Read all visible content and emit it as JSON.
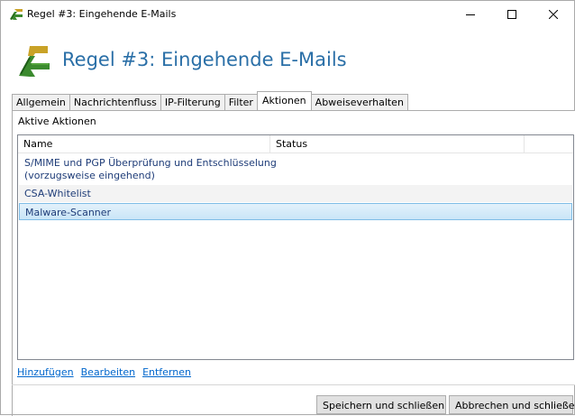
{
  "window": {
    "title": "Regel #3: Eingehende E-Mails",
    "controls": {
      "minimize": "minimize-icon",
      "maximize": "maximize-icon",
      "close": "close-icon"
    }
  },
  "header": {
    "title": "Regel #3: Eingehende E-Mails",
    "icon": "rule-arrows-icon"
  },
  "tabs": [
    {
      "label": "Allgemein",
      "active": false
    },
    {
      "label": "Nachrichtenfluss",
      "active": false
    },
    {
      "label": "IP-Filterung",
      "active": false
    },
    {
      "label": "Filter",
      "active": false
    },
    {
      "label": "Aktionen",
      "active": true
    },
    {
      "label": "Abweiseverhalten",
      "active": false
    }
  ],
  "actions": {
    "section_label": "Aktive Aktionen",
    "columns": {
      "name": "Name",
      "status": "Status"
    },
    "rows": [
      {
        "name_line1": "S/MIME und PGP Überprüfung und Entschlüsselung",
        "name_line2": "(vorzugsweise eingehend)",
        "status": ""
      },
      {
        "name": "CSA-Whitelist",
        "status": ""
      },
      {
        "name": "Malware-Scanner",
        "status": "",
        "selected": true
      }
    ]
  },
  "links": {
    "add": "Hinzufügen",
    "edit": "Bearbeiten",
    "remove": "Entfernen"
  },
  "buttons": {
    "save": "Speichern und schließen",
    "cancel": "Abbrechen und schließen"
  },
  "colors": {
    "header_title": "#2a6fa7",
    "link": "#0066cc",
    "row_text": "#1e3c78",
    "selection": "#c9e5f7"
  }
}
